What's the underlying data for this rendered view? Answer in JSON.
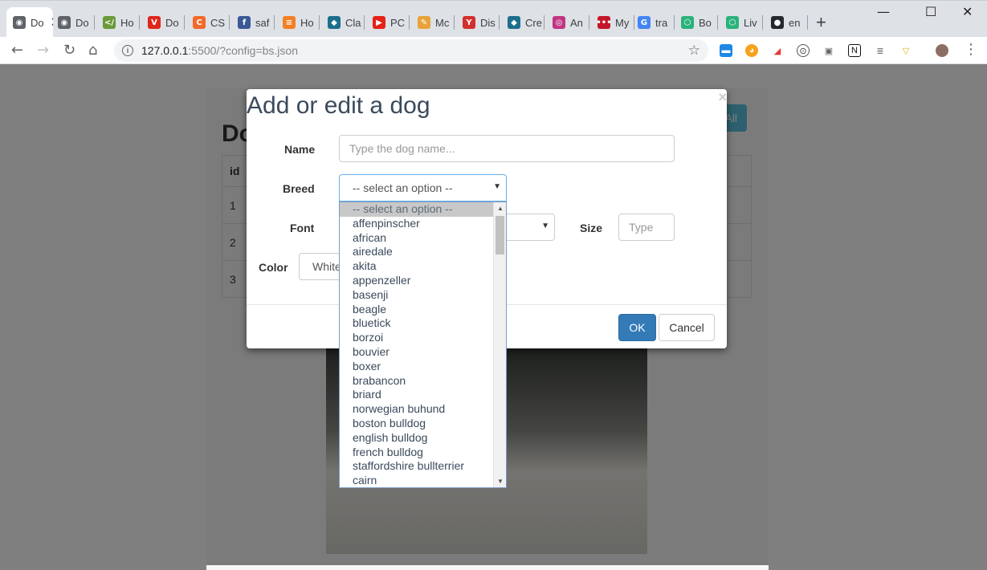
{
  "browser": {
    "tabs": [
      {
        "title": "Do",
        "icon": "globe-icon",
        "color": "#5f6368",
        "glyph": "◉",
        "active": true
      },
      {
        "title": "Do",
        "icon": "globe-icon",
        "color": "#5f6368",
        "glyph": "◉"
      },
      {
        "title": "Ho",
        "icon": "code-icon",
        "color": "#6a9a3a",
        "glyph": "</"
      },
      {
        "title": "Do",
        "icon": "vivaldi-icon",
        "color": "#e0271b",
        "glyph": "V"
      },
      {
        "title": "CS",
        "icon": "css-icon",
        "color": "#f26a2a",
        "glyph": "C"
      },
      {
        "title": "saf",
        "icon": "facebook-icon",
        "color": "#3b5998",
        "glyph": "f"
      },
      {
        "title": "Ho",
        "icon": "stackoverflow-icon",
        "color": "#f48024",
        "glyph": "≡"
      },
      {
        "title": "Cla",
        "icon": "cap-icon",
        "color": "#1c6e8c",
        "glyph": "◆"
      },
      {
        "title": "PC",
        "icon": "youtube-icon",
        "color": "#e62117",
        "glyph": "▶"
      },
      {
        "title": "Mc",
        "icon": "pen-icon",
        "color": "#e8a23a",
        "glyph": "✎"
      },
      {
        "title": "Dis",
        "icon": "figure-icon",
        "color": "#d2302c",
        "glyph": "Y"
      },
      {
        "title": "Cre",
        "icon": "cap-icon",
        "color": "#1c6e8c",
        "glyph": "◆"
      },
      {
        "title": "An",
        "icon": "instagram-icon",
        "color": "#c13584",
        "glyph": "◎"
      },
      {
        "title": "My",
        "icon": "meetup-icon",
        "color": "#c4162a",
        "glyph": "•••"
      },
      {
        "title": "tra",
        "icon": "google-icon",
        "color": "#4285f4",
        "glyph": "G"
      },
      {
        "title": "Bo",
        "icon": "hexagon-icon",
        "color": "#2ab27b",
        "glyph": "⬡"
      },
      {
        "title": "Liv",
        "icon": "hexagon-icon",
        "color": "#2ab27b",
        "glyph": "⬡"
      },
      {
        "title": "en",
        "icon": "github-icon",
        "color": "#24292e",
        "glyph": "●"
      }
    ],
    "url_host": "127.0.0.1",
    "url_path": ":5500/?config=bs.json"
  },
  "page": {
    "title": "Do",
    "all_button": "All",
    "table_header": "id",
    "rows": [
      "1",
      "2",
      "3"
    ]
  },
  "modal": {
    "title": "Add or edit a dog",
    "close": "×",
    "name_label": "Name",
    "name_placeholder": "Type the dog name...",
    "breed_label": "Breed",
    "breed_value": "-- select an option --",
    "font_label": "Font",
    "size_label": "Size",
    "size_placeholder": "Type",
    "color_label": "Color",
    "color_value": "White",
    "ok_label": "OK",
    "cancel_label": "Cancel"
  },
  "breed_options": [
    "-- select an option --",
    "affenpinscher",
    "african",
    "airedale",
    "akita",
    "appenzeller",
    "basenji",
    "beagle",
    "bluetick",
    "borzoi",
    "bouvier",
    "boxer",
    "brabancon",
    "briard",
    "norwegian buhund",
    "boston bulldog",
    "english bulldog",
    "french bulldog",
    "staffordshire bullterrier",
    "cairn"
  ]
}
